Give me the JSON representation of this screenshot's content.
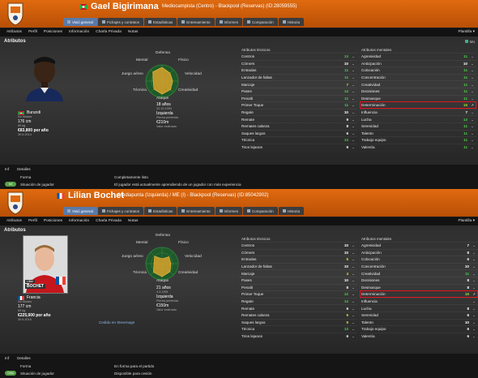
{
  "colors": {
    "header": "#e06a0f",
    "tab_active": "#5a7aa8",
    "highlight": "#e1141d",
    "high": "#4dcf4a",
    "mid": "#9fdc3f",
    "low": "#e9df3a",
    "normal": "#ffffff"
  },
  "p1": {
    "name": "Gael Bigirimana",
    "subtitle": "Mediocampista (Centro) - Blackpool (Reservas) (ID:28059555)",
    "tabs": [
      "Visió general",
      "Fichajes y contratos",
      "Estadísticas",
      "Entrenamiento",
      "Informes",
      "Comparación",
      "Historia"
    ],
    "active_tab": 0,
    "subnav": [
      "Atributos",
      "Perfil",
      "Posiciones",
      "Información",
      "Charla Privada",
      "Notas"
    ],
    "plantilla": "Plantilla",
    "section": "Atributos",
    "select_label": "Mo",
    "nationality": "Burundi",
    "info_left": [
      {
        "key": "No titulars",
        "value": ""
      },
      {
        "value": "176 cm",
        "key": ""
      },
      {
        "value": "69 kg",
        "key": ""
      },
      {
        "value": "€83,800 por año",
        "key": ""
      },
      {
        "key": "30.6.2014",
        "value": ""
      }
    ],
    "info_right": [
      {
        "value": "18 años",
        "key": "22.10.1993"
      },
      {
        "value": "Izquierda",
        "key": "Pierna preferida"
      },
      {
        "value": "€210m",
        "key": "Valor estimado"
      }
    ],
    "radar": [
      "Defensa",
      "Físico",
      "Velocidad",
      "Creatividad",
      "Ataque",
      "Técnica",
      "Juego aéreo",
      "Mental"
    ],
    "radar_levels": [
      0.85,
      0.7,
      0.65,
      0.75,
      0.8,
      0.7,
      0.55,
      0.8
    ],
    "tech_head": "Atributos técnicos",
    "tech": [
      {
        "n": "Centros",
        "v": "13",
        "c": "g"
      },
      {
        "n": "Córners",
        "v": "10",
        "c": "w"
      },
      {
        "n": "Entradas",
        "v": "11",
        "c": "g"
      },
      {
        "n": "Lanzador de faltas",
        "v": "11",
        "c": "g"
      },
      {
        "n": "Marcaje",
        "v": "7",
        "c": "y"
      },
      {
        "n": "Pases",
        "v": "14",
        "c": "g"
      },
      {
        "n": "Penalti",
        "v": "11",
        "c": "g"
      },
      {
        "n": "Primer Toque",
        "v": "11",
        "c": "g"
      },
      {
        "n": "Regate",
        "v": "10",
        "c": "w"
      },
      {
        "n": "Remate",
        "v": "9",
        "c": "w"
      },
      {
        "n": "Remates cabeza",
        "v": "8",
        "c": "w"
      },
      {
        "n": "Saques largos",
        "v": "6",
        "c": "w"
      },
      {
        "n": "Técnica",
        "v": "13",
        "c": "g"
      },
      {
        "n": "Tiros lejanos",
        "v": "9",
        "c": "w"
      }
    ],
    "mental_head": "Atributos mentales",
    "mental": [
      {
        "n": "Agresividad",
        "v": "11",
        "c": "g"
      },
      {
        "n": "Anticipación",
        "v": "10",
        "c": "w"
      },
      {
        "n": "Colocación",
        "v": "11",
        "c": "g"
      },
      {
        "n": "Concentración",
        "v": "11",
        "c": "g"
      },
      {
        "n": "Creatividad",
        "v": "11",
        "c": "g"
      },
      {
        "n": "Decisiones",
        "v": "11",
        "c": "g"
      },
      {
        "n": "Desmarque",
        "v": "11",
        "c": "g"
      },
      {
        "n": "Determinación",
        "v": "18",
        "c": "lg",
        "hl": true
      },
      {
        "n": "Influencia",
        "v": "7",
        "c": "w"
      },
      {
        "n": "Lucha",
        "v": "13",
        "c": "g"
      },
      {
        "n": "Serenidad",
        "v": "11",
        "c": "g"
      },
      {
        "n": "Talento",
        "v": "11",
        "c": "g"
      },
      {
        "n": "Trabajo equipo",
        "v": "11",
        "c": "g"
      },
      {
        "n": "Valentía",
        "v": "11",
        "c": "g"
      }
    ],
    "footer_tabs": [
      "Inf",
      "Detalles"
    ],
    "footer_rows": [
      {
        "badge": "",
        "label": "Forma",
        "value": "Completamente listo"
      },
      {
        "badge": "Inf",
        "label": "Situación de jugador",
        "value": "El jugador está actualmente aprendiendo de un jugador con más experiencia"
      }
    ]
  },
  "p2": {
    "name": "Lilian Bochet",
    "subtitle": "Mediapunta (Izquierda) / ME (I) - Blackpool (Reservas) (ID:85042902)",
    "tabs": [
      "Visió general",
      "Fichajes y contratos",
      "Estadísticas",
      "Entrenamiento",
      "Informes",
      "Comparación",
      "Historia"
    ],
    "active_tab": 0,
    "subnav": [
      "Atributos",
      "Perfil",
      "Posiciones",
      "Información",
      "Charla Privada",
      "Notas"
    ],
    "plantilla": "Plantilla",
    "section": "Atributos",
    "card_first": "Lilian",
    "card_last": "BOCHET",
    "nationality": "Francia",
    "info_left": [
      {
        "key": "No titulars",
        "value": ""
      },
      {
        "value": "177 cm",
        "key": ""
      },
      {
        "value": "69 kg",
        "key": ""
      },
      {
        "value": "€225,000 por año",
        "key": ""
      },
      {
        "key": "30.6.2016",
        "value": ""
      }
    ],
    "info_right": [
      {
        "value": "21 años",
        "key": "4.3.1991"
      },
      {
        "value": "Izquierda",
        "key": "Pierna preferida"
      },
      {
        "value": "€150m",
        "key": "Valor estimado"
      }
    ],
    "loan": "Cedido en Stevenage",
    "radar": [
      "Defensa",
      "Físico",
      "Velocidad",
      "Creatividad",
      "Ataque",
      "Técnica",
      "Juego aéreo",
      "Mental"
    ],
    "radar_levels": [
      0.3,
      0.6,
      0.55,
      0.7,
      0.8,
      0.75,
      0.5,
      0.65
    ],
    "tech_head": "Atributos técnicos",
    "tech": [
      {
        "n": "Centros",
        "v": "10",
        "c": "w"
      },
      {
        "n": "Córners",
        "v": "10",
        "c": "w"
      },
      {
        "n": "Entradas",
        "v": "5",
        "c": "y"
      },
      {
        "n": "Lanzador de faltas",
        "v": "10",
        "c": "w"
      },
      {
        "n": "Marcaje",
        "v": "4",
        "c": "y"
      },
      {
        "n": "Pases",
        "v": "10",
        "c": "w"
      },
      {
        "n": "Penalti",
        "v": "8",
        "c": "w"
      },
      {
        "n": "Primer Toque",
        "v": "12",
        "c": "g"
      },
      {
        "n": "Regate",
        "v": "13",
        "c": "g"
      },
      {
        "n": "Remate",
        "v": "6",
        "c": "w"
      },
      {
        "n": "Remates cabeza",
        "v": "5",
        "c": "y"
      },
      {
        "n": "Saques largos",
        "v": "5",
        "c": "y"
      },
      {
        "n": "Técnica",
        "v": "13",
        "c": "g"
      },
      {
        "n": "Tiros lejanos",
        "v": "6",
        "c": "w"
      }
    ],
    "mental_head": "Atributos mentales",
    "mental": [
      {
        "n": "Agresividad",
        "v": "7",
        "c": "w"
      },
      {
        "n": "Anticipación",
        "v": "8",
        "c": "w"
      },
      {
        "n": "Colocación",
        "v": "6",
        "c": "w"
      },
      {
        "n": "Concentración",
        "v": "10",
        "c": "w"
      },
      {
        "n": "Creatividad",
        "v": "11",
        "c": "g"
      },
      {
        "n": "Decisiones",
        "v": "8",
        "c": "w"
      },
      {
        "n": "Desmarque",
        "v": "8",
        "c": "w"
      },
      {
        "n": "Determinación",
        "v": "18",
        "c": "lg",
        "hl": true
      },
      {
        "n": "Influencia",
        "v": "",
        "c": "w"
      },
      {
        "n": "Lucha",
        "v": "8",
        "c": "w"
      },
      {
        "n": "Serenidad",
        "v": "6",
        "c": "w"
      },
      {
        "n": "Talento",
        "v": "10",
        "c": "w"
      },
      {
        "n": "Trabajo equipo",
        "v": "6",
        "c": "w"
      },
      {
        "n": "Valentía",
        "v": "6",
        "c": "w"
      }
    ],
    "footer_tabs": [
      "Inf",
      "Detalles"
    ],
    "footer_rows": [
      {
        "badge": "",
        "label": "Forma",
        "value": "En forma para el partido"
      },
      {
        "badge": "Cesi",
        "label": "Situación de jugador",
        "value": "Disponible para cesión"
      }
    ]
  }
}
